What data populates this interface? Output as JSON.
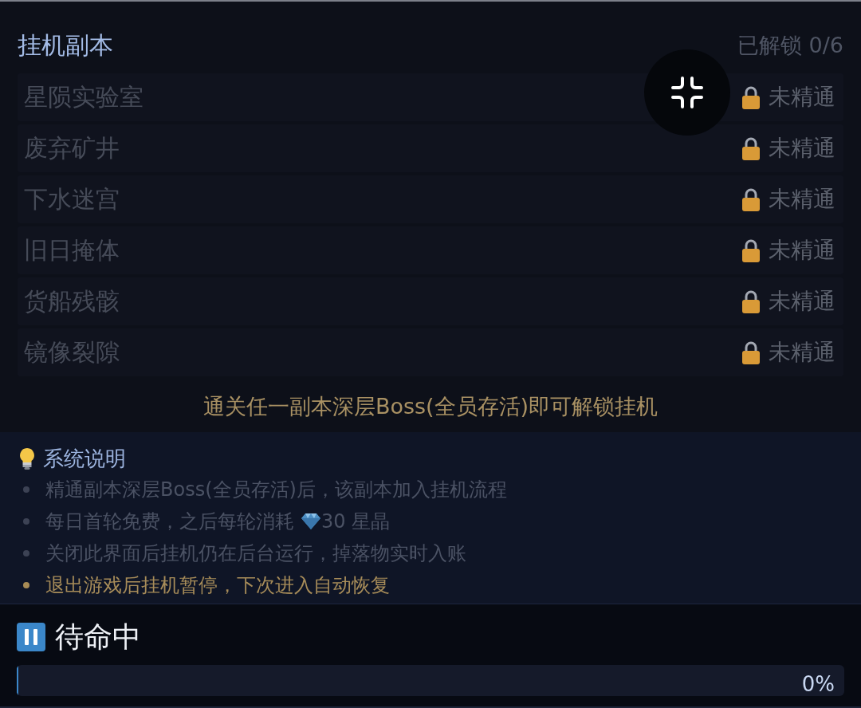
{
  "section": {
    "title": "挂机副本",
    "unlocked": "已解锁 0/6"
  },
  "dungeons": [
    {
      "name": "星陨实验室",
      "status": "未精通",
      "locked": true
    },
    {
      "name": "废弃矿井",
      "status": "未精通",
      "locked": true
    },
    {
      "name": "下水迷宫",
      "status": "未精通",
      "locked": true
    },
    {
      "name": "旧日掩体",
      "status": "未精通",
      "locked": true
    },
    {
      "name": "货船残骸",
      "status": "未精通",
      "locked": true
    },
    {
      "name": "镜像裂隙",
      "status": "未精通",
      "locked": true
    }
  ],
  "unlock_hint": "通关任一副本深层Boss(全员存活)即可解锁挂机",
  "info": {
    "title": "系统说明",
    "items": [
      {
        "text": "精通副本深层Boss(全员存活)后，该副本加入挂机流程",
        "highlight": false
      },
      {
        "text": "每日首轮免费，之后每轮消耗",
        "cost": "30 星晶",
        "highlight": false
      },
      {
        "text": "关闭此界面后挂机仍在后台运行，掉落物实时入账",
        "highlight": false
      },
      {
        "text": "退出游戏后挂机暂停，下次进入自动恢复",
        "highlight": true
      }
    ]
  },
  "status": {
    "kind": "paused",
    "label": "待命中",
    "level": 0,
    "percent": "0%"
  }
}
